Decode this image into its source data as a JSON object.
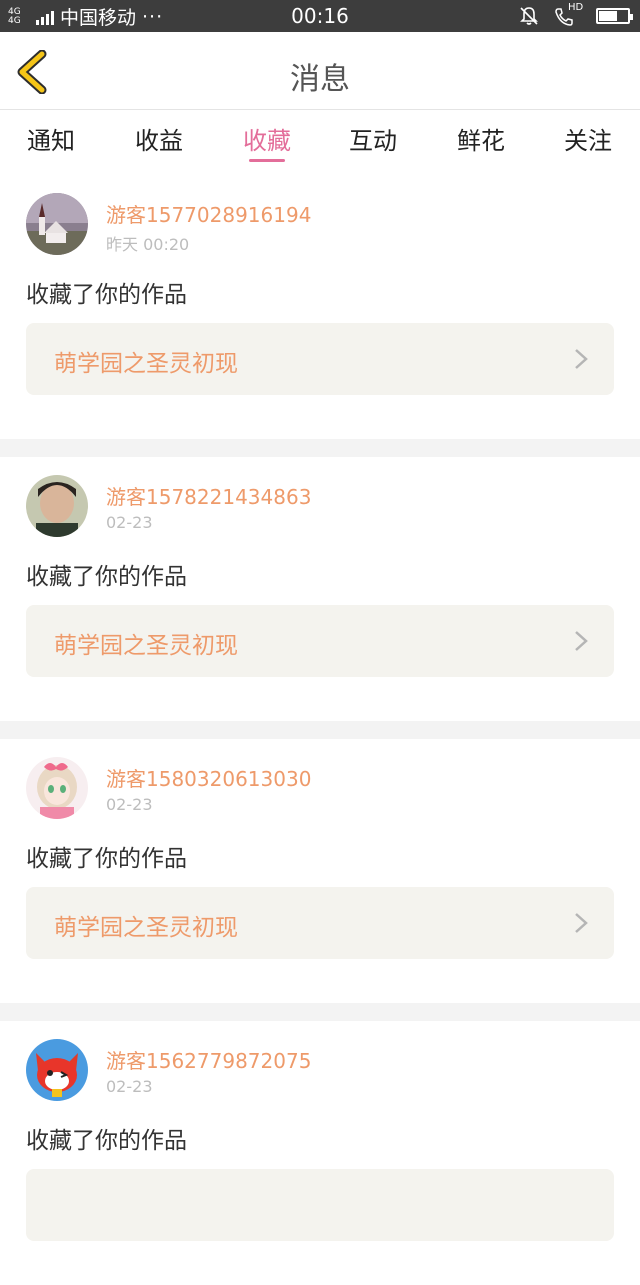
{
  "status_bar": {
    "network": "4G 4G",
    "carrier": "中国移动",
    "dots": "···",
    "time": "00:16",
    "hd": "HD"
  },
  "header": {
    "title": "消息",
    "back_icon": "chevron-left-icon",
    "accent_color": "#f5c518"
  },
  "tabs": [
    {
      "label": "通知",
      "active": false
    },
    {
      "label": "收益",
      "active": false
    },
    {
      "label": "收藏",
      "active": true
    },
    {
      "label": "互动",
      "active": false
    },
    {
      "label": "鲜花",
      "active": false
    },
    {
      "label": "关注",
      "active": false
    }
  ],
  "colors": {
    "active_tab": "#e36e9a",
    "username": "#ee9a6a",
    "work_bg": "#f4f3ee"
  },
  "messages": [
    {
      "user": "游客1577028916194",
      "time": "昨天 00:20",
      "action": "收藏了你的作品",
      "work": "萌学园之圣灵初现"
    },
    {
      "user": "游客1578221434863",
      "time": "02-23",
      "action": "收藏了你的作品",
      "work": "萌学园之圣灵初现"
    },
    {
      "user": "游客1580320613030",
      "time": "02-23",
      "action": "收藏了你的作品",
      "work": "萌学园之圣灵初现"
    },
    {
      "user": "游客1562779872075",
      "time": "02-23",
      "action": "收藏了你的作品",
      "work": ""
    }
  ]
}
